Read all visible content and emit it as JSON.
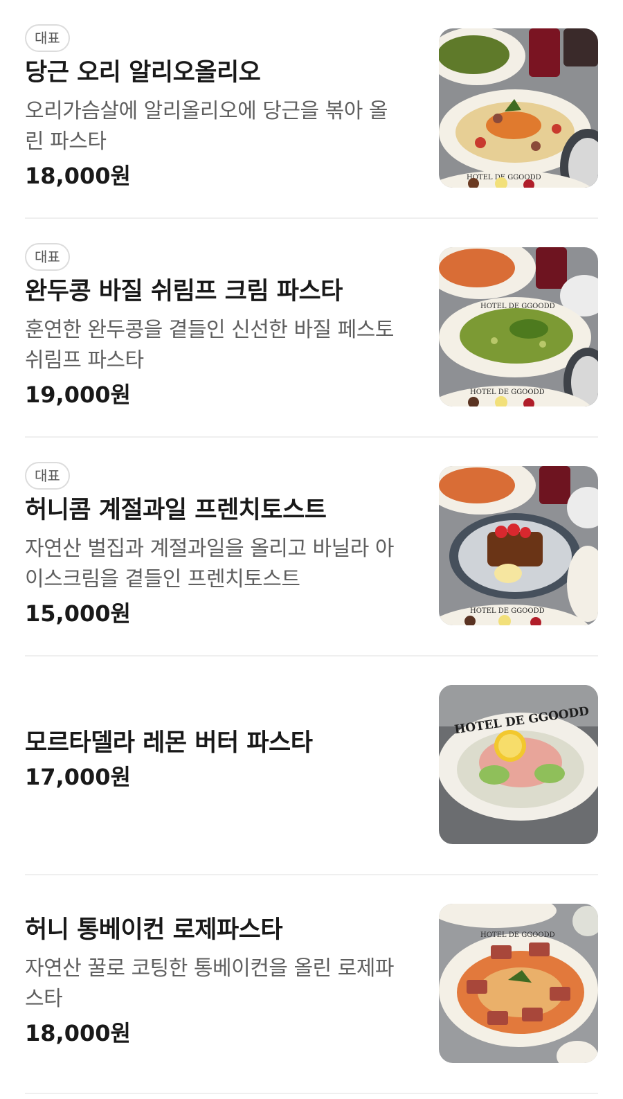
{
  "menu": {
    "items": [
      {
        "badge": "대표",
        "name": "당근 오리 알리오올리오",
        "desc_line1": "오리가슴살에 알리올리오에 당근을 볶아 올",
        "desc_line2": "린 파스타",
        "price": "18,000원",
        "image_icon": "duck-carrot-aglio-olio-photo"
      },
      {
        "badge": "대표",
        "name": "완두콩 바질 쉬림프 크림 파스타",
        "desc_line1": "훈연한 완두콩을 곁들인 신선한 바질 페스토",
        "desc_line2": "쉬림프 파스타",
        "price": "19,000원",
        "image_icon": "pea-basil-shrimp-pasta-photo"
      },
      {
        "badge": "대표",
        "name": "허니콤 계절과일 프렌치토스트",
        "desc_line1": "자연산 벌집과 계절과일을 올리고 바닐라 아",
        "desc_line2": "이스크림을 곁들인 프렌치토스트",
        "price": "15,000원",
        "image_icon": "honeycomb-french-toast-photo"
      },
      {
        "name": "모르타델라 레몬 버터 파스타",
        "price": "17,000원",
        "image_icon": "mortadella-lemon-butter-pasta-photo"
      },
      {
        "name": "허니 통베이컨 로제파스타",
        "desc_line1": "자연산 꿀로 코팅한 통베이컨을 올린 로제파",
        "desc_line2": "스타",
        "price": "18,000원",
        "image_icon": "honey-bacon-rose-pasta-photo"
      }
    ],
    "plate_text": "HOTEL DE GGOODD"
  },
  "colors": {
    "title": "#191919",
    "desc": "#5f5f5f",
    "badge_border": "#dcdcdc",
    "divider": "#efefef"
  }
}
